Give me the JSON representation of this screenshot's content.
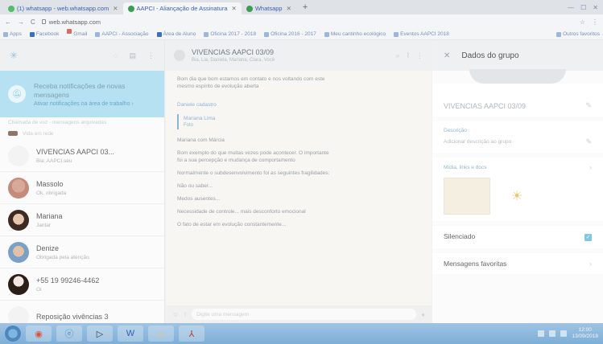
{
  "browser": {
    "tabs": [
      {
        "label": "(1) whatsapp - web.whatsapp.com",
        "active": false
      },
      {
        "label": "AAPCI - Aliançação de Assinatura",
        "active": true
      },
      {
        "label": "Whatsapp",
        "active": false
      }
    ],
    "new_tab": "+",
    "url": "web.whatsapp.com",
    "bookmarks": [
      {
        "label": "Apps"
      },
      {
        "label": "Facebook"
      },
      {
        "label": "Gmail"
      },
      {
        "label": "AAPCI - Associação"
      },
      {
        "label": "Área de Aluno"
      },
      {
        "label": "Oficina 2017 - 2018"
      },
      {
        "label": "Oficina 2016 - 2017"
      },
      {
        "label": "Meu cantinho ecológico"
      },
      {
        "label": "Eventos AAPCI 2018"
      }
    ],
    "bookmarks_other": "Outros favoritos"
  },
  "sidebar": {
    "notification": {
      "title": "Receba notificações de novas mensagens",
      "action": "Ativar notificações na área de trabalho ›"
    },
    "faded_row_1": "Chamada de voz · mensagens arquivadas",
    "faded_row_2": "Vida em rede",
    "chats": [
      {
        "name": "VIVENCIAS AAPCI 03...",
        "sub": "Bia: AAPCI.seu",
        "time": "",
        "avatar": "blank"
      },
      {
        "name": "Massolo",
        "sub": "Ok, obrigada",
        "time": "",
        "avatar": "massolo"
      },
      {
        "name": "Mariana",
        "sub": "Jantar",
        "time": "",
        "avatar": "mariana"
      },
      {
        "name": "Denize",
        "sub": "Obrigada pela atenção",
        "time": "",
        "avatar": "denize"
      },
      {
        "name": "+55 19 99246-4462",
        "sub": "Oi",
        "time": "",
        "avatar": "phone"
      },
      {
        "name": "Reposição vivências 3",
        "sub": "",
        "time": "",
        "avatar": "blank"
      }
    ]
  },
  "conversation": {
    "title": "VIVENCIAS AAPCI 03/09",
    "subtitle": "Bia, Lia, Daniela, Mariana, Clara, Você",
    "messages": [
      {
        "type": "text",
        "text": "Bom dia que bom estamos em contato e nos voltando com este mesmo espírito de evolução aberta"
      },
      {
        "type": "link",
        "text": "Daniele cadastro"
      },
      {
        "type": "quote",
        "name": "Mariana Lima",
        "sub": "Foto"
      },
      {
        "type": "text",
        "text": "Mariana com Márcia"
      },
      {
        "type": "text",
        "text": "Bom exemplo do que muitas vezes pode acontecer. O importante foi a sua percepção e mudança de comportamento"
      },
      {
        "type": "text",
        "text": "Normalmente o subdesenvolvimento foi as seguintes fragilidades:"
      },
      {
        "type": "text",
        "text": "Não ou saber..."
      },
      {
        "type": "text",
        "text": "Medos ausentes..."
      },
      {
        "type": "text",
        "text": "Necessidade de controle... mais desconforto emocional"
      },
      {
        "type": "text",
        "text": "O fato de estar em evolução constantemente..."
      }
    ],
    "composer_placeholder": "Digite uma mensagem"
  },
  "panel": {
    "title": "Dados do grupo",
    "group_name": "VIVENCIAS AAPCI 03/09",
    "description_label": "Descrição",
    "description_value": "Adicionar descrição ao grupo",
    "media_label": "Mídia, links e docs",
    "silenced_label": "Silenciado",
    "silenced_sub": "",
    "favorites_label": "Mensagens favoritas"
  },
  "taskbar": {
    "apps": [
      "chrome",
      "ie",
      "media",
      "word",
      "folder",
      "pdf"
    ],
    "clock_time": "12:00",
    "clock_date": "13/09/2018"
  },
  "colors": {
    "notification_bg": "#b6e1f2",
    "accent": "#8fb3d6",
    "taskbar": "#8cb8dd"
  }
}
